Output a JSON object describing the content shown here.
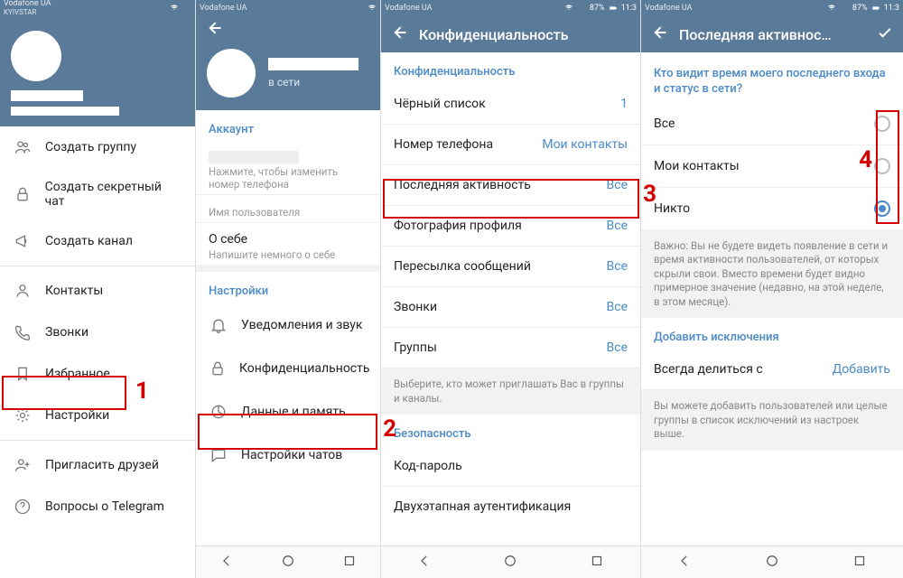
{
  "status": {
    "carrier": "Vodafone UA",
    "sub": "KYIVSTAR",
    "battery": "87%",
    "time": "11:3"
  },
  "col1": {
    "menu": {
      "create_group": "Создать группу",
      "secret_chat": "Создать секретный чат",
      "create_channel": "Создать канал",
      "contacts": "Контакты",
      "calls": "Звонки",
      "favorites": "Избранное",
      "settings": "Настройки",
      "invite": "Пригласить друзей",
      "faq": "Вопросы о Telegram"
    }
  },
  "col2": {
    "status_online": "в сети",
    "sec_account": "Аккаунт",
    "phone_hint": "Нажмите, чтобы изменить номер телефона",
    "username_label": "Имя пользователя",
    "about_label": "О себе",
    "about_hint": "Напишите немного о себе",
    "sec_settings": "Настройки",
    "s_notify": "Уведомления и звук",
    "s_privacy": "Конфиденциальность",
    "s_data": "Данные и память",
    "s_chat": "Настройки чатов"
  },
  "col3": {
    "title": "Конфиденциальность",
    "sec_privacy": "Конфиденциальность",
    "blacklist": "Чёрный список",
    "blacklist_val": "1",
    "phone": "Номер телефона",
    "phone_val": "Мои контакты",
    "lastseen": "Последняя активность",
    "lastseen_val": "Все",
    "photo": "Фотография профиля",
    "photo_val": "Все",
    "fwd": "Пересылка сообщений",
    "fwd_val": "Все",
    "calls": "Звонки",
    "calls_val": "Все",
    "groups": "Группы",
    "groups_val": "Все",
    "groups_note": "Выберите, кто может приглашать Вас в группы и каналы.",
    "sec_security": "Безопасность",
    "passcode": "Код-пароль",
    "twostep": "Двухэтапная аутентификация"
  },
  "col4": {
    "title": "Последняя активнос…",
    "question": "Кто видит время моего последнего входа и статус в сети?",
    "opt_all": "Все",
    "opt_contacts": "Мои контакты",
    "opt_nobody": "Никто",
    "note": "Важно: Вы не будете видеть появление в сети и время активности пользователей, от которых скрыли свои. Вместо времени будет видно примерное значение (недавно, на этой неделе, в этом месяце).",
    "sec_exceptions": "Добавить исключения",
    "always_share": "Всегда делиться с",
    "always_share_val": "Добавить",
    "exc_note": "Вы можете добавить пользователей или целые группы в список исключений из настроек выше."
  },
  "annot": {
    "n1": "1",
    "n2": "2",
    "n3": "3",
    "n4": "4"
  }
}
